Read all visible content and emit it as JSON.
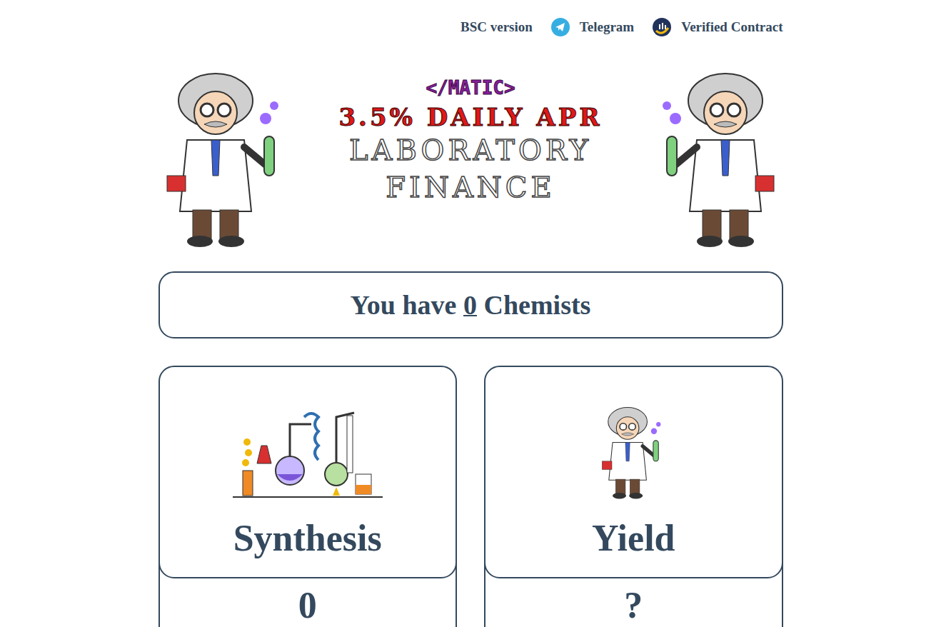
{
  "nav": {
    "links": [
      {
        "label": "BSC version",
        "icon": "none"
      },
      {
        "label": "Telegram",
        "icon": "telegram"
      },
      {
        "label": "Verified Contract",
        "icon": "verified"
      }
    ]
  },
  "banner": {
    "tag": "</MATIC>",
    "headline": "3.5% DAILY APR",
    "name_lines": [
      "LABORATORY",
      "FINANCE"
    ]
  },
  "chemists": {
    "prefix": "You have",
    "count": "0",
    "suffix": "Chemists"
  },
  "cards": [
    {
      "title": "Synthesis",
      "value": "0",
      "kind": "lab"
    },
    {
      "title": "Yield",
      "value": "?",
      "kind": "chemist"
    }
  ]
}
